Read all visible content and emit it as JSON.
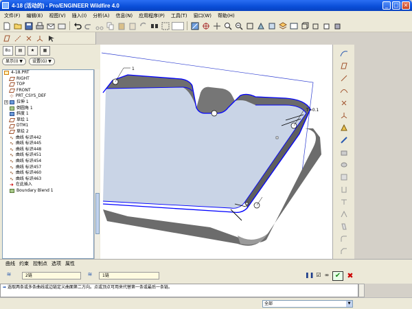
{
  "window": {
    "title": "4-18 (活动的) - Pro/ENGINEER Wildfire 4.0",
    "controls": [
      "_",
      "□",
      "×"
    ]
  },
  "menu": [
    "文件(F)",
    "编辑(E)",
    "视图(V)",
    "插入(I)",
    "分析(A)",
    "信息(N)",
    "应用程序(P)",
    "工具(T)",
    "窗口(W)",
    "帮助(H)"
  ],
  "panel": {
    "show_label": "显示(I) ▼",
    "settings_label": "设置(G) ▼"
  },
  "tree": [
    {
      "label": "4-18.PRT",
      "icon": "part-icon"
    },
    {
      "label": "RIGHT",
      "icon": "datum-plane-icon"
    },
    {
      "label": "TOP",
      "icon": "datum-plane-icon"
    },
    {
      "label": "FRONT",
      "icon": "datum-plane-icon"
    },
    {
      "label": "PRT_CSYS_DEF",
      "icon": "csys-icon"
    },
    {
      "label": "拉伸 1",
      "icon": "extrude-icon",
      "expandable": true
    },
    {
      "label": "倒圆角 1",
      "icon": "round-icon"
    },
    {
      "label": "斜度 1",
      "icon": "draft-icon"
    },
    {
      "label": "草绘 1",
      "icon": "sketch-icon"
    },
    {
      "label": "DTM1",
      "icon": "datum-plane-icon"
    },
    {
      "label": "草绘 2",
      "icon": "sketch-icon"
    },
    {
      "label": "曲线 标识442",
      "icon": "curve-icon"
    },
    {
      "label": "曲线 标识445",
      "icon": "curve-icon"
    },
    {
      "label": "曲线 标识448",
      "icon": "curve-icon"
    },
    {
      "label": "曲线 标识451",
      "icon": "curve-icon"
    },
    {
      "label": "曲线 标识454",
      "icon": "curve-icon"
    },
    {
      "label": "曲线 标识457",
      "icon": "curve-icon"
    },
    {
      "label": "曲线 标识460",
      "icon": "curve-icon"
    },
    {
      "label": "曲线 标识463",
      "icon": "curve-icon"
    },
    {
      "label": "在此插入",
      "icon": "insert-here-icon"
    },
    {
      "label": "Boundary Blend 1",
      "icon": "boundary-blend-icon"
    }
  ],
  "viewport": {
    "annotations": [
      "1",
      "T=0.1"
    ]
  },
  "dashboard": {
    "tabs": [
      "曲线",
      "约束",
      "控制点",
      "选项",
      "属性"
    ],
    "first_direction_value": "2链",
    "second_direction_value": "1链"
  },
  "message": "选取两条或多条曲线或边链定义曲面第二方向。点或顶点可用来代替第一条或最后一条链。",
  "filter": {
    "value": "全部"
  },
  "colors": {
    "title_bar": "#0a4ed8",
    "edge_highlight": "#0000ff",
    "surface": "#c9d4e6"
  }
}
